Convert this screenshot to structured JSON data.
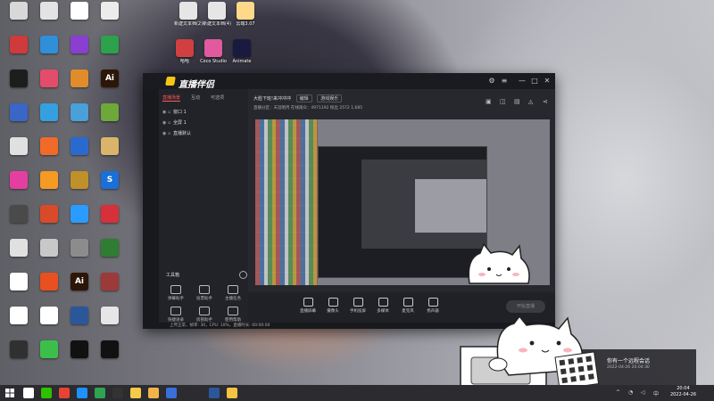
{
  "desktop": {
    "icons": [
      {
        "label": "",
        "color": "#d8d8d8"
      },
      {
        "label": "",
        "color": "#e3e3e3"
      },
      {
        "label": "",
        "color": "#ffffff"
      },
      {
        "label": "",
        "color": "#ececec"
      },
      {
        "label": "",
        "color": "#cf3a3a"
      },
      {
        "label": "",
        "color": "#2f8fd8"
      },
      {
        "label": "",
        "color": "#8a3fd0"
      },
      {
        "label": "",
        "color": "#2da14b"
      },
      {
        "label": "",
        "color": "#1d1d1d"
      },
      {
        "label": "",
        "color": "#e44c6c"
      },
      {
        "label": "",
        "color": "#e08c2a"
      },
      {
        "label": "Ai",
        "color": "#2b1608"
      },
      {
        "label": "",
        "color": "#3a66c6"
      },
      {
        "label": "",
        "color": "#34a0e0"
      },
      {
        "label": "",
        "color": "#4aa0d8"
      },
      {
        "label": "",
        "color": "#6ea83a"
      },
      {
        "label": "",
        "color": "#e0e0e0"
      },
      {
        "label": "",
        "color": "#f06a2a"
      },
      {
        "label": "",
        "color": "#2a6acf"
      },
      {
        "label": "",
        "color": "#d9b46a"
      },
      {
        "label": "",
        "color": "#e43fa0"
      },
      {
        "label": "",
        "color": "#f59a23"
      },
      {
        "label": "",
        "color": "#c0902a"
      },
      {
        "label": "S",
        "color": "#1a6fd8"
      },
      {
        "label": "",
        "color": "#4a4a4a"
      },
      {
        "label": "",
        "color": "#d84a2a"
      },
      {
        "label": "",
        "color": "#2a9cff"
      },
      {
        "label": "",
        "color": "#d6303a"
      },
      {
        "label": "",
        "color": "#e0e0e0"
      },
      {
        "label": "",
        "color": "#c8c8c8"
      },
      {
        "label": "",
        "color": "#8c8c8c"
      },
      {
        "label": "",
        "color": "#2e7d32"
      },
      {
        "label": "",
        "color": "#ffffff"
      },
      {
        "label": "",
        "color": "#e85020"
      },
      {
        "label": "Ai",
        "color": "#2b1608"
      },
      {
        "label": "",
        "color": "#9c3a3a"
      },
      {
        "label": "",
        "color": "#ffffff"
      },
      {
        "label": "",
        "color": "#ffffff"
      },
      {
        "label": "",
        "color": "#2b579a"
      },
      {
        "label": "",
        "color": "#e6e6e6"
      },
      {
        "label": "",
        "color": "#303030"
      },
      {
        "label": "",
        "color": "#3cbf4a"
      },
      {
        "label": "",
        "color": "#111111"
      },
      {
        "label": "",
        "color": "#111111"
      }
    ],
    "top_files": [
      {
        "label": "新建文本档(2)",
        "color": "#e6e6e6"
      },
      {
        "label": "新建文本档(4)",
        "color": "#e6e6e6"
      },
      {
        "label": "云端3.07",
        "color": "#ffd98a"
      },
      {
        "label": "哈哈",
        "color": "#d04040"
      },
      {
        "label": "Coco Studio",
        "color": "#e05aa0"
      },
      {
        "label": "Animate",
        "color": "#1a1a40"
      }
    ]
  },
  "app": {
    "title": "直播伴侣",
    "tabs": [
      "直播场景",
      "互动",
      "可选项"
    ],
    "scenes": [
      {
        "label": "窗口 1"
      },
      {
        "label": "全屏 1"
      },
      {
        "label": "直播默认"
      }
    ],
    "tools_header": "工具箱",
    "tools": [
      {
        "label": "弹幕助手"
      },
      {
        "label": "投票助手"
      },
      {
        "label": "主播任务"
      },
      {
        "label": "快捷语录"
      },
      {
        "label": "房管助手"
      },
      {
        "label": "使用帮助"
      },
      {
        "label": "滤镜"
      },
      {
        "label": "虚拟形象"
      },
      {
        "label": "弹幕机"
      }
    ],
    "room_title": "大脸下班!来冲冲冲",
    "room_pill1": "编辑",
    "room_pill2": "游戏娱乐",
    "stats": "直播分区：天涯明月  在线观众：4971192  粉丝 2572  1,685",
    "bottom_tools": [
      {
        "label": "直播屏幕"
      },
      {
        "label": "摄像头"
      },
      {
        "label": "手机投屏"
      },
      {
        "label": "多媒体"
      },
      {
        "label": "麦克风"
      },
      {
        "label": "扬声器"
      }
    ],
    "live_button": "开始直播",
    "status": "上传正常，帧率: 30，CPU: 10%，直播时长: 00:00:00"
  },
  "remote_notice": {
    "title": "你有一个远程会话",
    "sub": "2022-04-26 20:04:30"
  },
  "taskbar": {
    "time": "20:04",
    "date": "2022-04-26",
    "apps": [
      {
        "name": "search-icon",
        "color": "#ffffff"
      },
      {
        "name": "wechat-icon",
        "color": "#2dc100"
      },
      {
        "name": "chrome-icon",
        "color": "#e94235"
      },
      {
        "name": "store-icon",
        "color": "#1e90ff"
      },
      {
        "name": "sheets-icon",
        "color": "#2da44e"
      },
      {
        "name": "app-icon",
        "color": "#333333"
      },
      {
        "name": "edit-icon",
        "color": "#f7c948"
      },
      {
        "name": "explorer-icon",
        "color": "#f2b34a"
      },
      {
        "name": "photo-icon",
        "color": "#3a6fd8"
      },
      {
        "name": "word-icon",
        "color": "#2b579a"
      },
      {
        "name": "folder-icon",
        "color": "#f5c542"
      }
    ]
  }
}
